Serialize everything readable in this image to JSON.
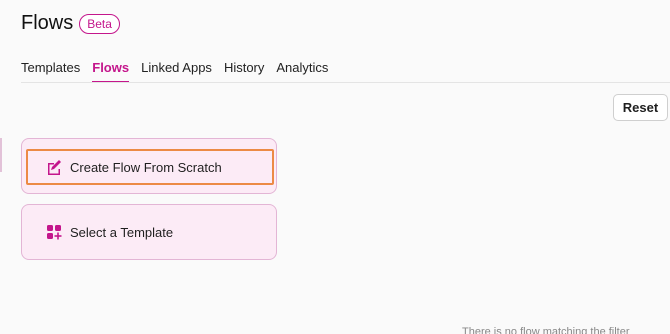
{
  "header": {
    "title": "Flows",
    "badge": "Beta"
  },
  "tabs": [
    {
      "label": "Templates",
      "active": false
    },
    {
      "label": "Flows",
      "active": true
    },
    {
      "label": "Linked Apps",
      "active": false
    },
    {
      "label": "History",
      "active": false
    },
    {
      "label": "Analytics",
      "active": false
    }
  ],
  "toolbar": {
    "reset_label": "Reset"
  },
  "cards": {
    "scratch": {
      "label": "Create Flow From Scratch",
      "icon": "edit-icon"
    },
    "template": {
      "label": "Select a Template",
      "icon": "apps-add-icon"
    }
  },
  "footer": {
    "partial_text": "There is no flow matching the filter"
  },
  "colors": {
    "accent": "#c4168c",
    "card_bg": "#fcebf6",
    "highlight_border": "#ec8a45"
  }
}
